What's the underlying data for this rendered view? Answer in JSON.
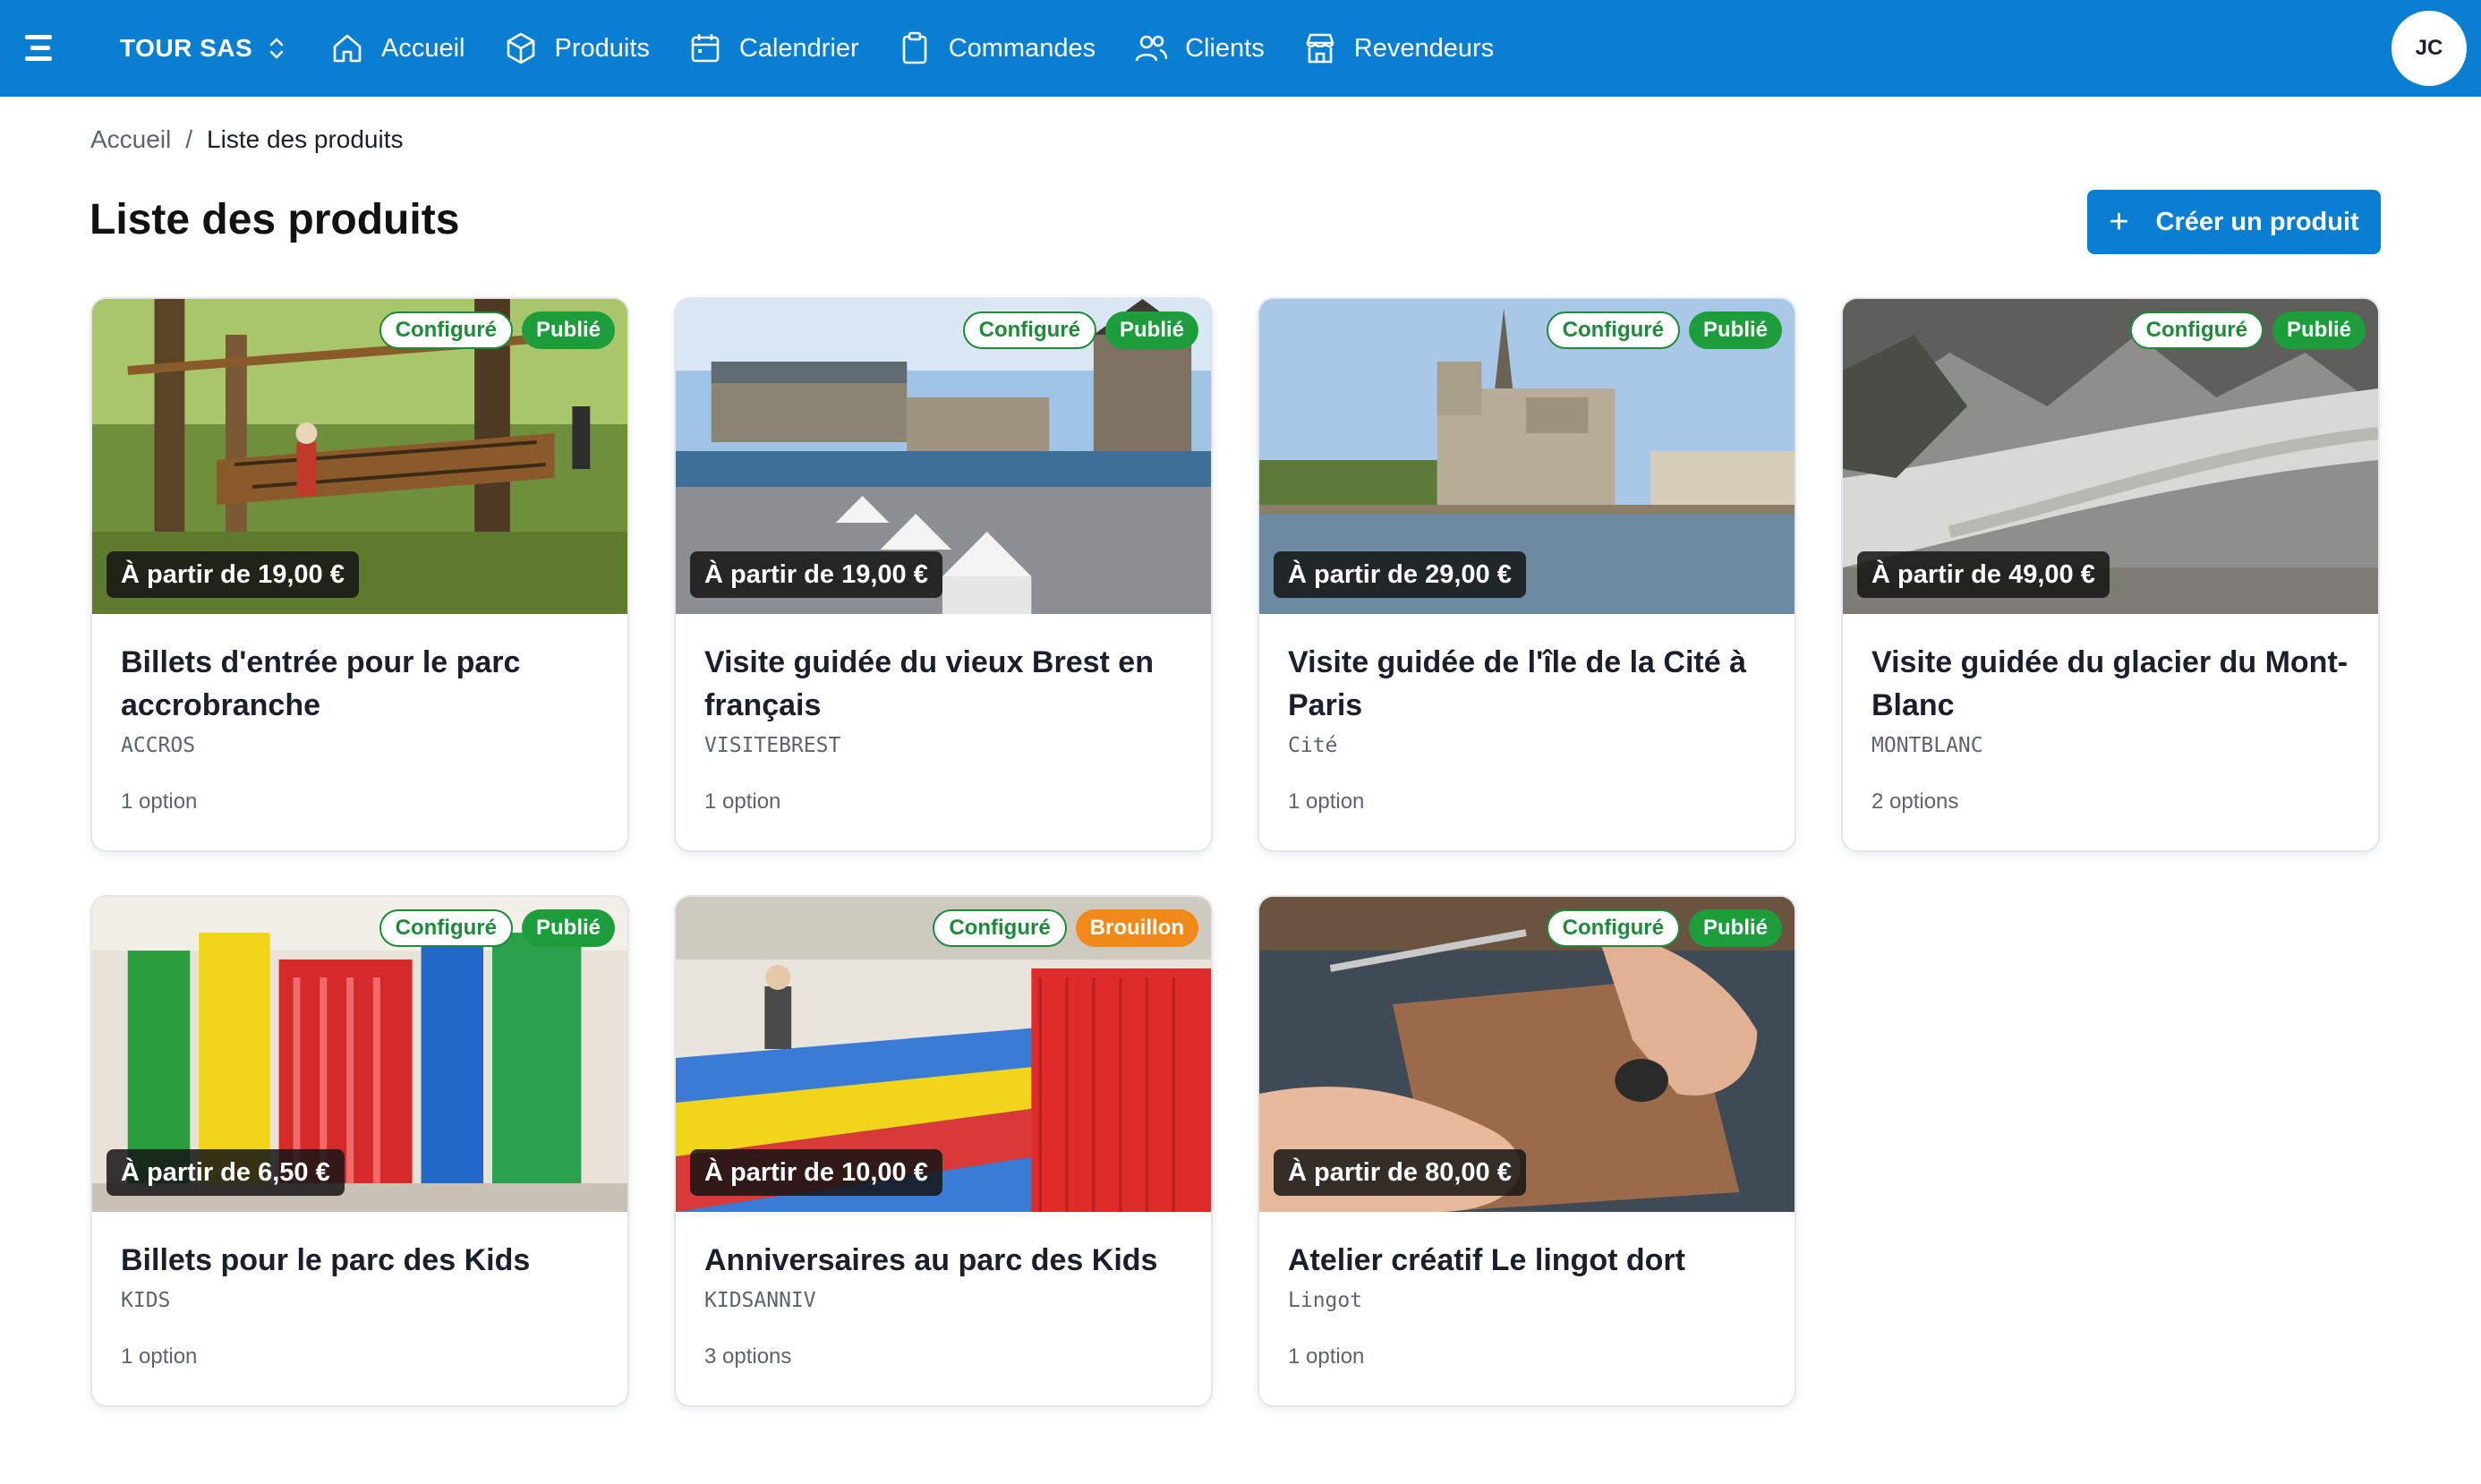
{
  "app": {
    "org_name": "TOUR SAS",
    "user_initials": "JC",
    "brand_color": "#0a7fd2"
  },
  "nav": [
    {
      "label": "Accueil",
      "icon": "home-icon"
    },
    {
      "label": "Produits",
      "icon": "box-icon"
    },
    {
      "label": "Calendrier",
      "icon": "calendar-icon"
    },
    {
      "label": "Commandes",
      "icon": "clipboard-icon"
    },
    {
      "label": "Clients",
      "icon": "users-icon"
    },
    {
      "label": "Revendeurs",
      "icon": "store-icon"
    }
  ],
  "breadcrumb": {
    "home": "Accueil",
    "separator": "/",
    "current": "Liste des produits"
  },
  "page": {
    "title": "Liste des produits",
    "create_label": "Créer un produit"
  },
  "products": [
    {
      "title": "Billets d'entrée pour le parc accrobranche",
      "code": "ACCROS",
      "price": "À partir de 19,00 €",
      "options": "1 option",
      "status_config": "Configuré",
      "status_pub": "Publié",
      "pub_state": "published",
      "image": "treetop-adventure-park"
    },
    {
      "title": "Visite guidée du vieux Brest en français",
      "code": "VISITEBREST",
      "price": "À partir de 19,00 €",
      "options": "1 option",
      "status_config": "Configuré",
      "status_pub": "Publié",
      "pub_state": "published",
      "image": "brest-harbor"
    },
    {
      "title": "Visite guidée de l'île de la Cité à Paris",
      "code": "Cité",
      "price": "À partir de 29,00 €",
      "options": "1 option",
      "status_config": "Configuré",
      "status_pub": "Publié",
      "pub_state": "published",
      "image": "notre-dame"
    },
    {
      "title": "Visite guidée du glacier du Mont-Blanc",
      "code": "MONTBLANC",
      "price": "À partir de 49,00 €",
      "options": "2 options",
      "status_config": "Configuré",
      "status_pub": "Publié",
      "pub_state": "published",
      "image": "glacier-valley"
    },
    {
      "title": "Billets pour le parc des Kids",
      "code": "KIDS",
      "price": "À partir de 6,50 €",
      "options": "1 option",
      "status_config": "Configuré",
      "status_pub": "Publié",
      "pub_state": "published",
      "image": "inflatable-slide"
    },
    {
      "title": "Anniversaires au parc des Kids",
      "code": "KIDSANNIV",
      "price": "À partir de 10,00 €",
      "options": "3 options",
      "status_config": "Configuré",
      "status_pub": "Brouillon",
      "pub_state": "draft",
      "image": "trampoline-park"
    },
    {
      "title": "Atelier créatif Le lingot dort",
      "code": "Lingot",
      "price": "À partir de 80,00 €",
      "options": "1 option",
      "status_config": "Configuré",
      "status_pub": "Publié",
      "pub_state": "published",
      "image": "leather-workshop"
    }
  ]
}
